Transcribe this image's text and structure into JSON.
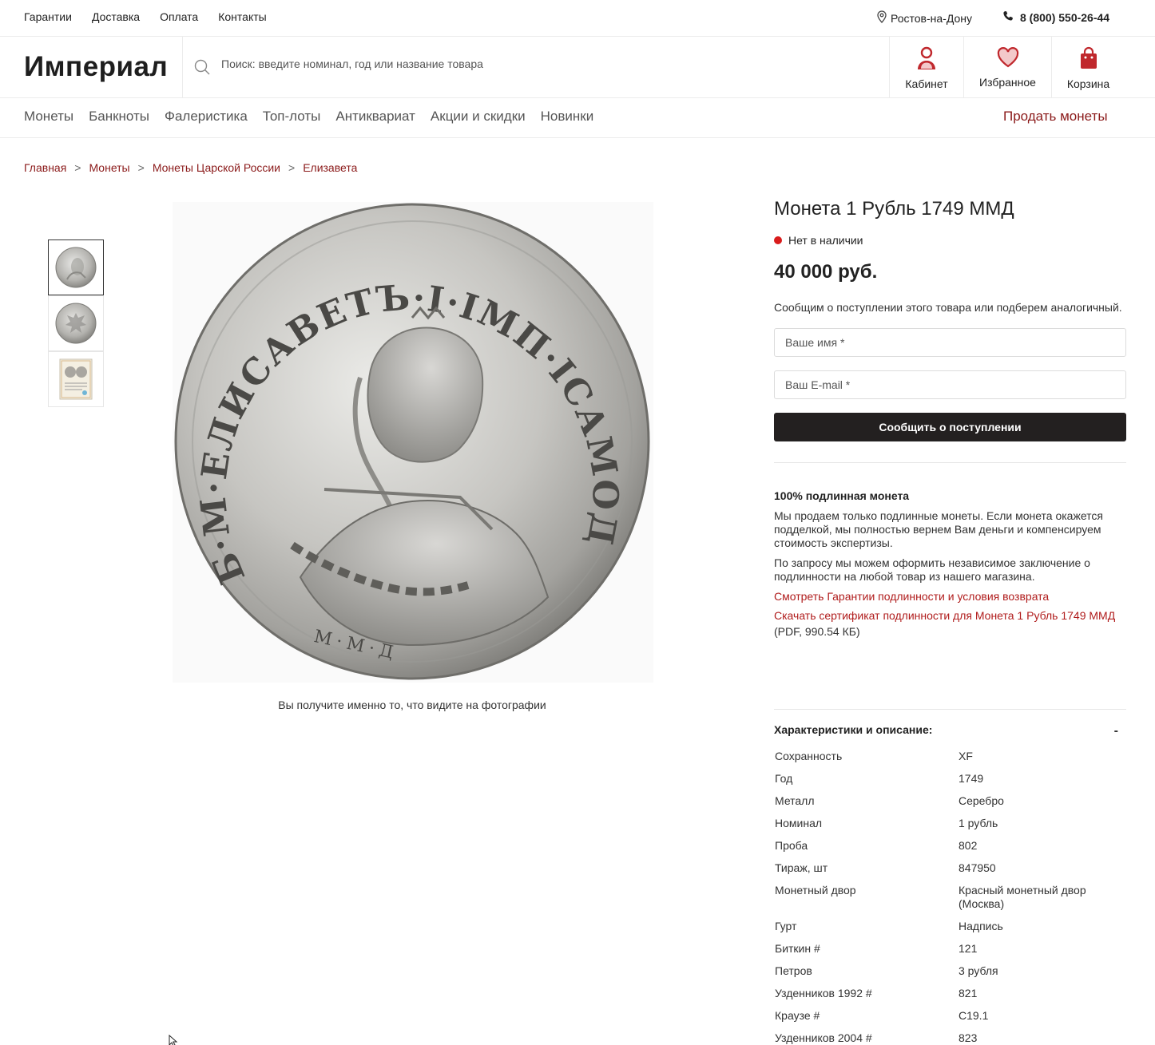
{
  "topbar": {
    "links": [
      "Гарантии",
      "Доставка",
      "Оплата",
      "Контакты"
    ],
    "city": "Ростов-на-Дону",
    "phone": "8 (800) 550-26-44"
  },
  "header": {
    "logo": "Империал",
    "search_placeholder": "Поиск: введите номинал, год или название товара",
    "cabinet": "Кабинет",
    "favorites": "Избранное",
    "cart": "Корзина"
  },
  "nav": {
    "items": [
      "Монеты",
      "Банкноты",
      "Фалеристика",
      "Топ-лоты",
      "Антиквариат",
      "Акции и скидки",
      "Новинки"
    ],
    "sell": "Продать монеты"
  },
  "breadcrumb": [
    "Главная",
    "Монеты",
    "Монеты Царской России",
    "Елизавета"
  ],
  "gallery": {
    "caption": "Вы получите именно то, что видите на фотографии",
    "thumbs": [
      "obverse",
      "reverse",
      "certificate"
    ],
    "active_thumb": 0,
    "coin_legend": "Б·М·ЕЛИСАВЕТЪ·I·IМП·IСАМОД·ВСЕРОС·",
    "mint_mark": "М·М·Д"
  },
  "product": {
    "title": "Монета 1 Рубль 1749 ММД",
    "stock": "Нет в наличии",
    "price": "40 000 руб.",
    "notify_text": "Сообщим о поступлении этого товара или подберем аналогичный.",
    "name_placeholder": "Ваше имя *",
    "email_placeholder": "Ваш E-mail *",
    "notify_button": "Сообщить о поступлении"
  },
  "authenticity": {
    "title": "100% подлинная монета",
    "p1": "Мы продаем только подлинные монеты. Если монета окажется подделкой, мы полностью вернем Вам деньги и компенсируем стоимость экспертизы.",
    "p2": "По запросу мы можем оформить независимое заключение о подлинности на любой товар из нашего магазина.",
    "link1": "Смотреть Гарантии подлинности и условия возврата",
    "link2": "Скачать сертификат подлинности для Монета 1 Рубль 1749 ММД",
    "pdf": "(PDF, 990.54 КБ)"
  },
  "specs": {
    "title": "Характеристики и описание:",
    "toggle": "-",
    "rows": [
      {
        "k": "Сохранность",
        "v": "XF"
      },
      {
        "k": "Год",
        "v": "1749"
      },
      {
        "k": "Металл",
        "v": "Серебро"
      },
      {
        "k": "Номинал",
        "v": "1 рубль"
      },
      {
        "k": "Проба",
        "v": "802"
      },
      {
        "k": "Тираж, шт",
        "v": "847950"
      },
      {
        "k": "Монетный двор",
        "v": "Красный монетный двор (Москва)"
      },
      {
        "k": "Гурт",
        "v": "Надпись"
      },
      {
        "k": "Биткин #",
        "v": "121"
      },
      {
        "k": "Петров",
        "v": "3 рубля"
      },
      {
        "k": "Узденников 1992 #",
        "v": "821"
      },
      {
        "k": "Краузе #",
        "v": "C19.1"
      },
      {
        "k": "Узденников 2004 #",
        "v": "823"
      }
    ]
  },
  "colors": {
    "accent": "#8b1a1a",
    "link_red": "#b01c1c",
    "stock_dot": "#d91c1c",
    "button_dark": "#232020"
  }
}
